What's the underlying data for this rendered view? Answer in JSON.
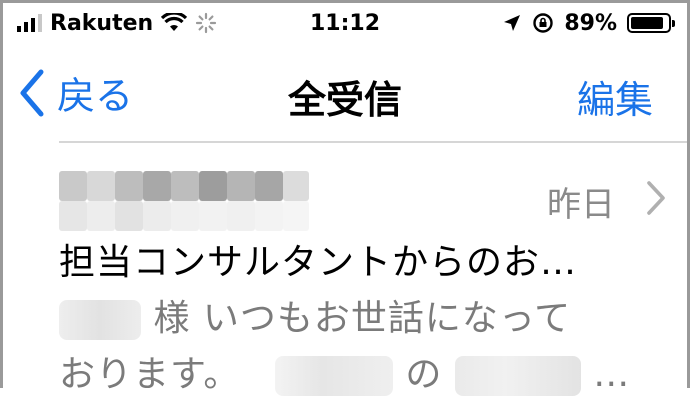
{
  "status": {
    "carrier": "Rakuten",
    "time": "11:12",
    "battery": "89%",
    "battery_level": 0.89,
    "icons": [
      "signal-icon",
      "wifi-icon",
      "loading-icon",
      "location-arrow-icon",
      "rotation-lock-icon",
      "battery-icon"
    ]
  },
  "nav": {
    "back_label": "戻る",
    "title": "全受信",
    "edit_label": "編集"
  },
  "message": {
    "date": "昨日",
    "subject": "担当コンサルタントからのお…",
    "preview_1a": "様 いつもお世話になって",
    "preview_2a": "おります。",
    "preview_2b": "の",
    "preview_2c": "…"
  },
  "colors": {
    "accent": "#1a73e8",
    "secondary_text": "#8a8a8a"
  }
}
